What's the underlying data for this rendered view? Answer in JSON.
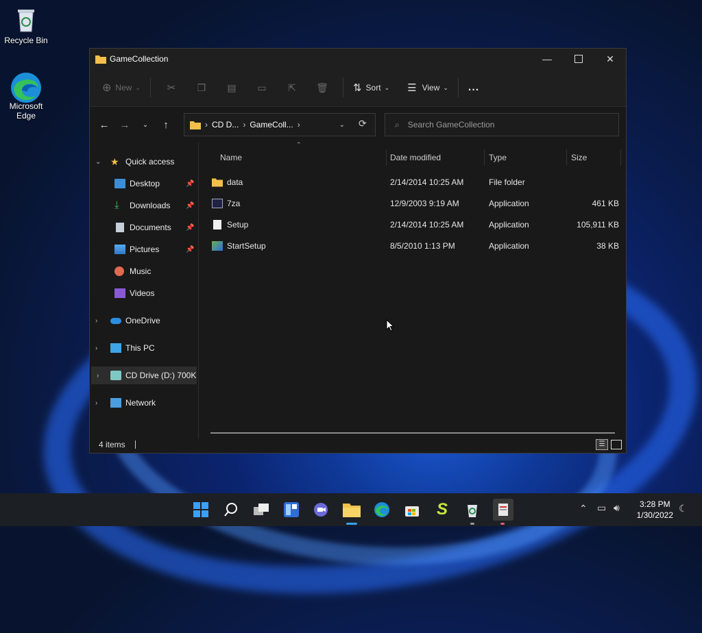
{
  "desktop": {
    "recycle_bin": "Recycle Bin",
    "edge_line1": "Microsoft",
    "edge_line2": "Edge"
  },
  "window": {
    "title": "GameCollection",
    "toolbar": {
      "new": "New",
      "sort": "Sort",
      "view": "View",
      "more": "..."
    },
    "address": {
      "segment1": "CD D...",
      "segment2": "GameColl..."
    },
    "search_placeholder": "Search GameCollection",
    "nav": {
      "quick_access": "Quick access",
      "items": [
        "Desktop",
        "Downloads",
        "Documents",
        "Pictures",
        "Music",
        "Videos"
      ],
      "onedrive": "OneDrive",
      "this_pc": "This PC",
      "cd_drive": "CD Drive (D:) 700K",
      "network": "Network"
    },
    "columns": {
      "name": "Name",
      "date": "Date modified",
      "type": "Type",
      "size": "Size"
    },
    "files": [
      {
        "name": "data",
        "date": "2/14/2014 10:25 AM",
        "type": "File folder",
        "size": ""
      },
      {
        "name": "7za",
        "date": "12/9/2003 9:19 AM",
        "type": "Application",
        "size": "461 KB"
      },
      {
        "name": "Setup",
        "date": "2/14/2014 10:25 AM",
        "type": "Application",
        "size": "105,911 KB"
      },
      {
        "name": "StartSetup",
        "date": "8/5/2010 1:13 PM",
        "type": "Application",
        "size": "38 KB"
      }
    ],
    "status": "4 items"
  },
  "taskbar": {
    "time": "3:28 PM",
    "date": "1/30/2022"
  },
  "colors": {
    "accent": "#3aa0ff",
    "folder": "#f2c04a",
    "window_bg": "#191919"
  }
}
